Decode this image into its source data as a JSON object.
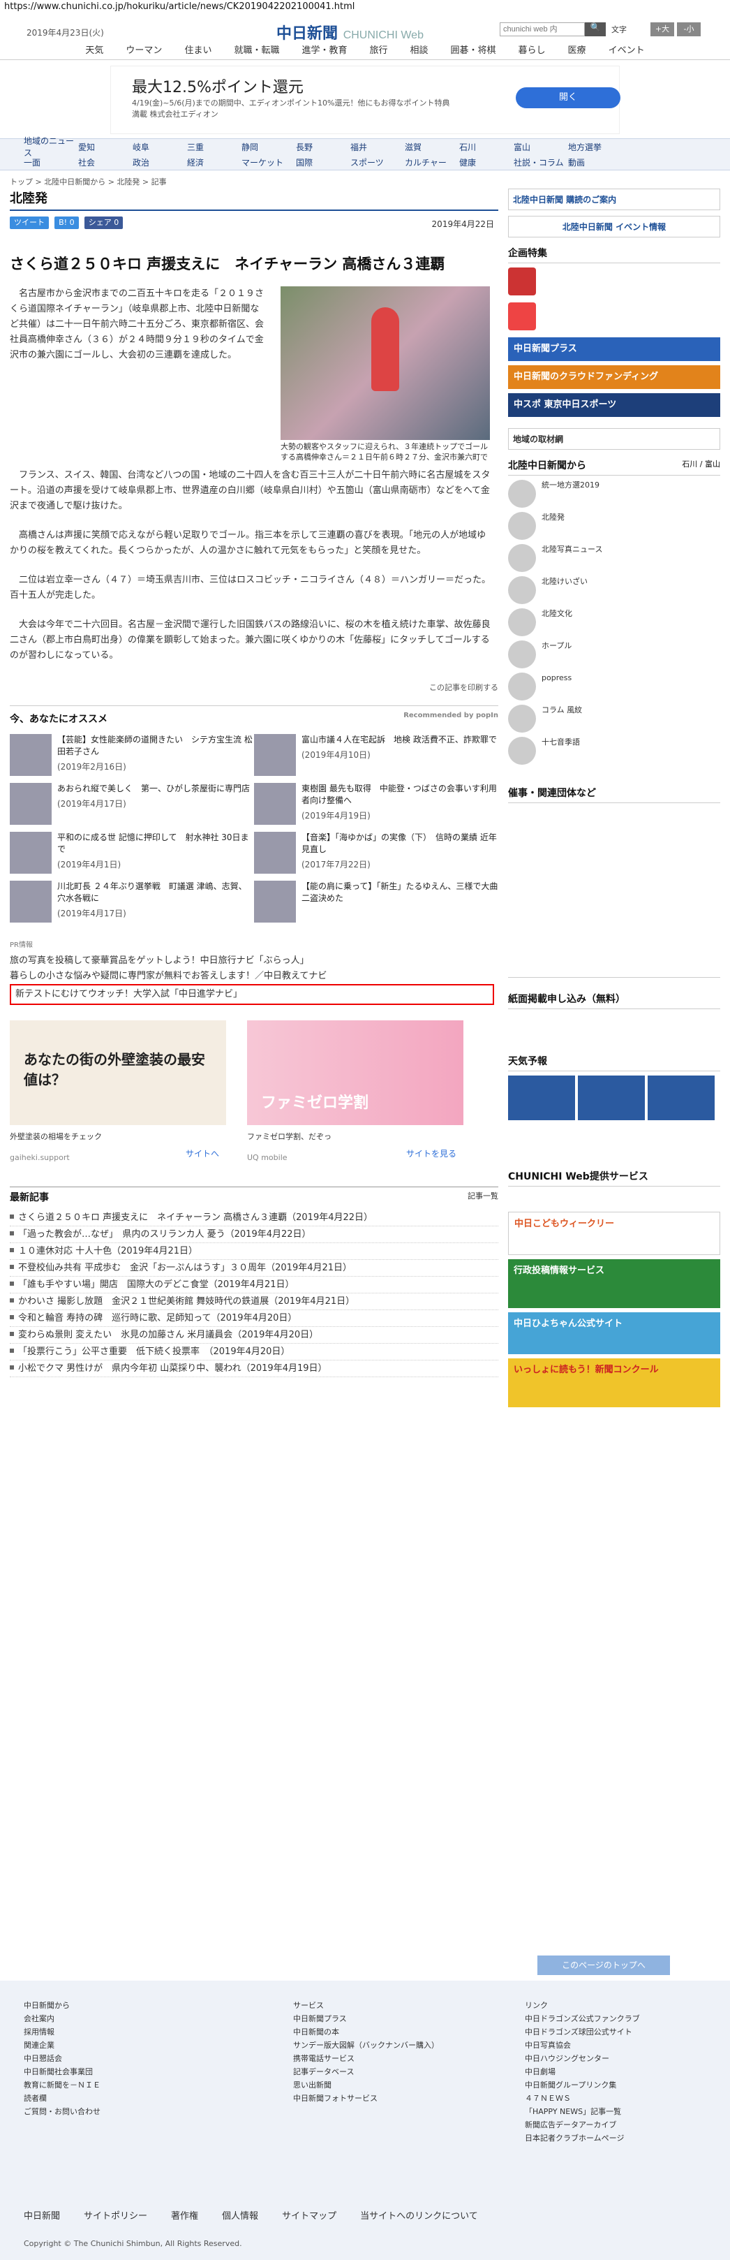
{
  "url": "https://www.chunichi.co.jp/hokuriku/article/news/CK2019042202100041.html",
  "header": {
    "date": "2019年4月23日(火)",
    "logo": "中日新聞",
    "logo_sub": "CHUNICHI Web",
    "search_placeholder": "chunichi web 内",
    "search_btn": "🔍",
    "fontsize": "文字",
    "fs_large": "+大",
    "fs_small": "-小"
  },
  "gnav": [
    "天気",
    "ウーマン",
    "住まい",
    "就職・転職",
    "進学・教育",
    "旅行",
    "相談",
    "囲碁・将棋",
    "暮らし",
    "医療",
    "イベント"
  ],
  "ad1": {
    "headline": "最大12.5%ポイント還元",
    "sub": "4/19(金)~5/6(月)までの期間中、エディオンポイント10%還元！他にもお得なポイント特典満載 株式会社エディオン",
    "button": "開く"
  },
  "subnav": [
    [
      "地域のニュース",
      "愛知",
      "岐阜",
      "三重",
      "静岡",
      "長野",
      "福井",
      "滋賀",
      "石川",
      "富山",
      "地方選挙"
    ],
    [
      "一面",
      "社会",
      "政治",
      "経済",
      "マーケット",
      "国際",
      "スポーツ",
      "カルチャー",
      "健康",
      "社説・コラム",
      "動画"
    ]
  ],
  "breadcrumb": "トップ > 北陸中日新聞から > 北陸発 > 記事",
  "section": "北陸発",
  "social": [
    "ツイート",
    "B! 0",
    "シェア 0"
  ],
  "pubdate": "2019年4月22日",
  "headline": "さくら道２５０キロ 声援支えに　ネイチャーラン 高橋さん３連覇",
  "lead": "名古屋市から金沢市までの二百五十キロを走る「２０１９さくら道国際ネイチャーラン」（岐阜県郡上市、北陸中日新聞など共催）は二十一日午前六時二十五分ごろ、東京都新宿区、会社員高橋伸幸さん（３６）が２４時間９分１９秒のタイムで金沢市の兼六園にゴールし、大会初の三連覇を達成した。",
  "photo_caption": "大勢の観客やスタッフに迎えられ、３年連続トップでゴールする高橋伸幸さん＝２１日午前６時２７分、金沢市兼六町で",
  "body": [
    "フランス、スイス、韓国、台湾など八つの国・地域の二十四人を含む百三十三人が二十日午前六時に名古屋城をスタート。沿道の声援を受けて岐阜県郡上市、世界遺産の白川郷（岐阜県白川村）や五箇山（富山県南砺市）などをへて金沢まで夜通しで駆け抜けた。",
    "高橋さんは声援に笑顔で応えながら軽い足取りでゴール。指三本を示して三連覇の喜びを表現。「地元の人が地域ゆかりの桜を教えてくれた。長くつらかったが、人の温かさに触れて元気をもらった」と笑顔を見せた。",
    "二位は岩立幸一さん（４７）＝埼玉県吉川市、三位はロスコビッチ・ニコライさん（４８）＝ハンガリー＝だった。百十五人が完走した。",
    "大会は今年で二十六回目。名古屋－金沢間で運行した旧国鉄バスの路線沿いに、桜の木を植え続けた車掌、故佐藤良二さん（郡上市白鳥町出身）の偉業を顕彰して始まった。兼六園に咲くゆかりの木「佐藤桜」にタッチしてゴールするのが習わしになっている。"
  ],
  "print": "この記事を印刷する",
  "rec": {
    "title": "今、あなたにオススメ",
    "by": "Recommended by popIn",
    "items": [
      {
        "t": "【芸能】女性能楽師の道開きたい　シテ方宝生流 松田若子さん",
        "d": "(2019年2月16日)"
      },
      {
        "t": "富山市議４人在宅起訴　地検 政活費不正、詐欺罪で",
        "d": "(2019年4月10日)"
      },
      {
        "t": "あおられ縦で美しく　第一、ひがし茶屋街に専門店",
        "d": "(2019年4月17日)"
      },
      {
        "t": "東樹園 最先も取得　中能登・つばさの会事いす利用者向け整備へ",
        "d": "(2019年4月19日)"
      },
      {
        "t": "平和のに成る世 記憶に押印して　射水神社 30日まで",
        "d": "(2019年4月1日)"
      },
      {
        "t": "【音楽】「海ゆかば」の実像（下）　信時の業績 近年見直し",
        "d": "(2017年7月22日)"
      },
      {
        "t": "川北町長 ２４年ぶり選挙戦　町議選 津嶋、志賀、穴水各戦に",
        "d": "(2019年4月17日)"
      },
      {
        "t": "【能の肩に乗って】「新生」たるゆえん、三様で大曲二盗決めた",
        "d": ""
      }
    ]
  },
  "pr": {
    "label": "PR情報",
    "items": [
      "旅の写真を投稿して豪華賞品をゲットしよう！中日旅行ナビ「ぶらっ人」",
      "暮らしの小さな悩みや疑問に専門家が無料でお答えします！／中日教えてナビ",
      "新テストにむけてウオッチ！大学入試「中日進学ナビ」"
    ]
  },
  "ads2": [
    {
      "title": "あなたの街の外壁塗装の最安値は？",
      "cap": "外壁塗装の相場をチェック",
      "src": "gaiheki.support",
      "link": "サイトへ"
    },
    {
      "title": "ファミゼロ学割",
      "cap": "ファミゼロ学割、だぞっ",
      "src": "UQ mobile",
      "link": "サイトを見る"
    }
  ],
  "latest": {
    "title": "最新記事",
    "all": "記事一覧",
    "items": [
      "さくら道２５０キロ 声援支えに　ネイチャーラン 高橋さん３連覇（2019年4月22日）",
      "「過った教会が…なぜ」　県内のスリランカ人 憂う（2019年4月22日）",
      "１０連休対応 十人十色（2019年4月21日）",
      "不登校仙み共有 平成歩む　金沢「お一ぷんはうす」３０周年（2019年4月21日）",
      "「誰も手やすい場」開店　国際大のデどこ食堂（2019年4月21日）",
      "かわいさ 撮影し放題　金沢２１世紀美術館 舞妓時代の鉄道展（2019年4月21日）",
      "令和と輪音 寿持の碑　巡行時に歌、足師知って（2019年4月20日）",
      "変わらぬ景則 変えたい　氷見の加藤さん 米月議員会（2019年4月20日）",
      "「投票行こう」公平さ重要　低下続く投票率　（2019年4月20日）",
      "小松でクマ 男性けが　県内今年初 山菜採り中、襲われ（2019年4月19日）"
    ]
  },
  "side": {
    "kohd": "北陸中日新聞 購読のご案内",
    "event": "北陸中日新聞 イベント情報",
    "tokushu": "企画特集",
    "banners": [
      "中日新聞プラス",
      "中日新聞のクラウドファンディング",
      "中スポ 東京中日スポーツ"
    ],
    "chiiki": "地域の取材網",
    "kara": "北陸中日新聞から",
    "kara_links": [
      "石川",
      "富山"
    ],
    "items": [
      "統一地方選2019",
      "北陸発",
      "北陸写真ニュース",
      "北陸けいざい",
      "北陸文化",
      "ホープル",
      "popress",
      "コラム 風紋",
      "十七音季語"
    ],
    "kanren": "催事・関連団体など",
    "shimen": "紙面掲載申し込み（無料）",
    "tenki": "天気予報",
    "service": "CHUNICHI Web提供サービス",
    "bn2": [
      "中日こどもウィークリー",
      "行政投稿情報サービス",
      "中日ひよちゃん公式サイト",
      "いっしょに読もう！新聞コンクール"
    ]
  },
  "footer": {
    "cols": [
      [
        "中日新聞から",
        "会社案内",
        "採用情報",
        "関連企業",
        "中日懇話会",
        "中日新聞社会事業団",
        "教育に新聞を－ＮＩＥ",
        "読者欄",
        "ご質問・お問い合わせ"
      ],
      [
        "サービス",
        "中日新聞プラス",
        "中日新聞の本",
        "サンデー版大図解（バックナンバー購入）",
        "携帯電話サービス",
        "記事データベース",
        "思い出新聞",
        "中日新聞フォトサービス"
      ],
      [
        "リンク",
        "中日ドラゴンズ公式ファンクラブ",
        "中日ドラゴンズ球団公式サイト",
        "中日写真協会",
        "中日ハウジングセンター",
        "中日劇場",
        "中日新聞グループリンク集",
        "４７ＮＥＷＳ",
        "「HAPPY NEWS」記事一覧",
        "新聞広告データアーカイブ",
        "日本記者クラブホームページ"
      ]
    ],
    "nav": [
      "中日新聞",
      "サイトポリシー",
      "著作権",
      "個人情報",
      "サイトマップ",
      "当サイトへのリンクについて"
    ],
    "copy": "Copyright © The Chunichi Shimbun, All Rights Reserved.",
    "totop": "このページのトップへ"
  }
}
